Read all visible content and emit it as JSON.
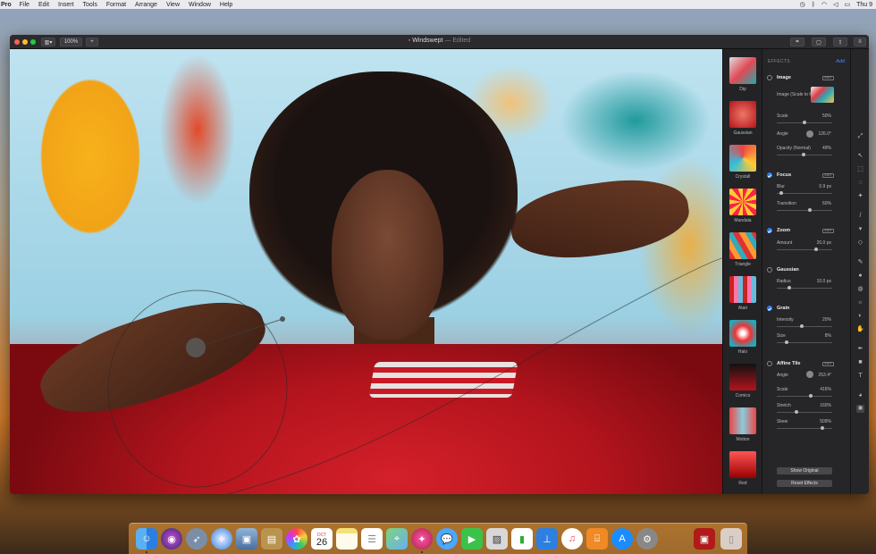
{
  "menubar": {
    "app_name": "Pro",
    "items": [
      "File",
      "Edit",
      "Insert",
      "Tools",
      "Format",
      "Arrange",
      "View",
      "Window",
      "Help"
    ],
    "clock": "Thu 9"
  },
  "window": {
    "title": "Windswept",
    "edited": "— Edited",
    "zoom": "100%"
  },
  "thumbnails": [
    "Dip",
    "Gaussian",
    "Crystall",
    "Mandala",
    "Triangle",
    "Atari",
    "Halo",
    "Comics",
    "Motion",
    "Red"
  ],
  "panel": {
    "header": "EFFECTS",
    "add_label": "Add",
    "edit_label": "EDIT",
    "image": {
      "name": "Image",
      "mode": "Image (Scale to Fill)",
      "scale_label": "Scale",
      "scale": "50%",
      "angle_label": "Angle",
      "angle": "126.0°",
      "opacity_label": "Opacity (Normal)",
      "opacity": "49%"
    },
    "focus": {
      "name": "Focus",
      "blur_label": "Blur",
      "blur": "0.9 px",
      "transition_label": "Transition",
      "transition": "60%"
    },
    "zoom": {
      "name": "Zoom",
      "amount_label": "Amount",
      "amount": "20.0 px"
    },
    "gaussian": {
      "name": "Gaussian",
      "radius_label": "Radius",
      "radius": "10.0 px"
    },
    "grain": {
      "name": "Grain",
      "intensity_label": "Intensity",
      "intensity": "20%",
      "size_label": "Size",
      "size": "8%"
    },
    "affine": {
      "name": "Affine Tile",
      "angle_label": "Angle",
      "angle": "253.4°",
      "scale_label": "Scale",
      "scale": "416%",
      "stretch_label": "Stretch",
      "stretch": "160%",
      "skew_label": "Skew",
      "skew": "509%"
    },
    "show_original": "Show Original",
    "reset_effects": "Reset Effects"
  },
  "sliders": {
    "scale": 0.5,
    "opacity": 0.49,
    "blur": 0.05,
    "transition": 0.6,
    "amount": 0.72,
    "radius": 0.2,
    "intensity": 0.45,
    "size": 0.15,
    "affine_scale": 0.62,
    "stretch": 0.35,
    "skew": 0.85
  },
  "dock": {
    "calendar_month": "OCT",
    "calendar_day": "26",
    "icons": [
      "finder-icon",
      "siri-icon",
      "launchpad-icon",
      "safari-icon",
      "photo-booth-icon",
      "notes-book-icon",
      "photos-icon",
      "calendar-icon",
      "notes-icon",
      "reminders-icon",
      "maps-icon",
      "pixelmator-icon",
      "messages-icon",
      "facetime-icon",
      "preview-icon",
      "numbers-icon",
      "keynote-icon",
      "music-icon",
      "books-icon",
      "app-store-icon",
      "system-preferences-icon",
      "photo-viewer-icon",
      "trash-icon"
    ]
  }
}
